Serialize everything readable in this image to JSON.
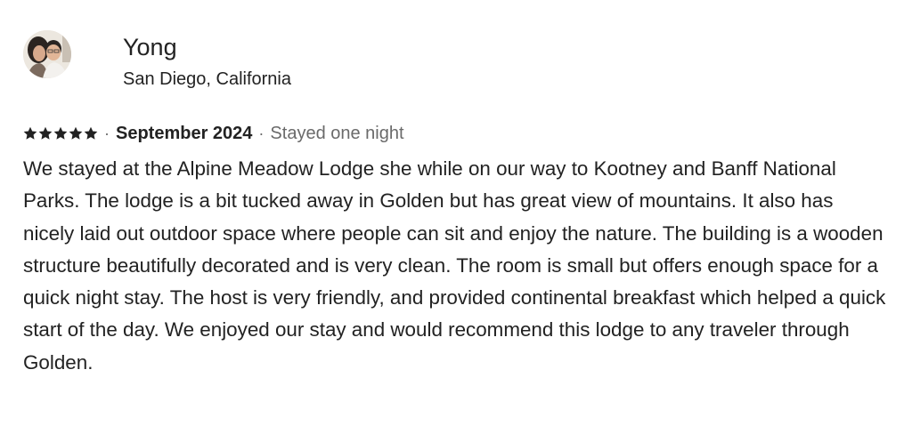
{
  "reviewer": {
    "name": "Yong",
    "location": "San Diego, California"
  },
  "review": {
    "rating": 5,
    "rating_max": 5,
    "separator": "·",
    "date": "September 2024",
    "stay_length": "Stayed one night",
    "text": "We stayed at the Alpine Meadow Lodge she while on our way to Kootney and Banff National Parks. The lodge is a bit tucked away in Golden but has great view of mountains. It also has nicely laid out outdoor space where people can sit and enjoy the nature. The building is a wooden structure beautifully decorated and is very clean. The room is small but offers enough space for a quick night stay. The host is very friendly, and provided continental breakfast which helped a quick start of the day. We enjoyed our stay and would recommend this lodge to any traveler through Golden."
  },
  "icons": {
    "star": "star-icon"
  },
  "colors": {
    "text": "#222222",
    "muted": "#6a6a6a",
    "star": "#222222"
  }
}
